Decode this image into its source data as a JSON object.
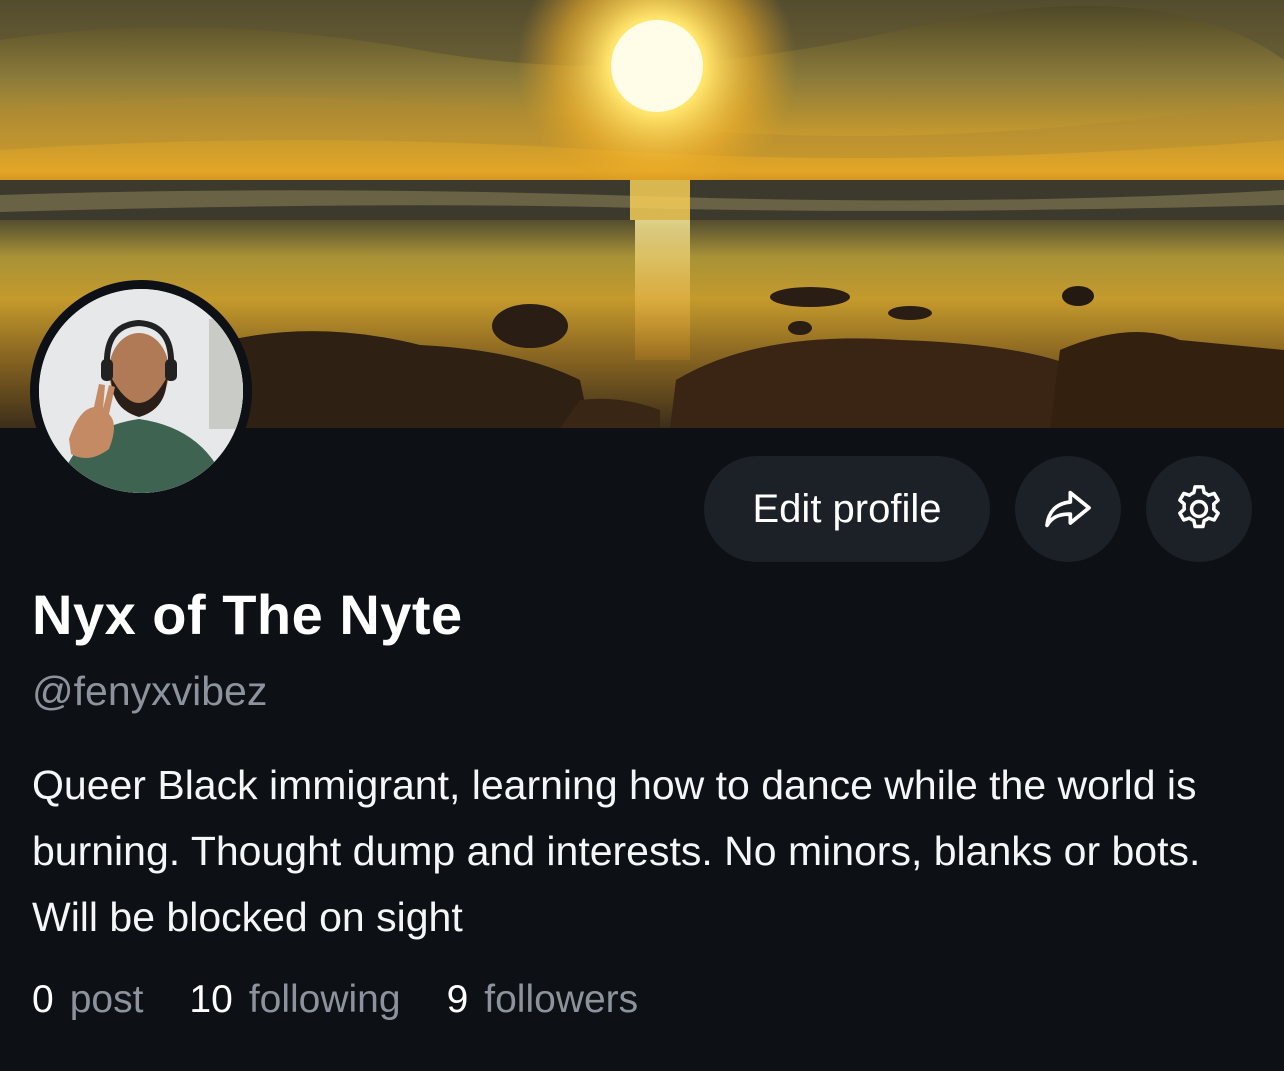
{
  "profile": {
    "display_name": "Nyx of The Nyte",
    "handle": "@fenyxvibez",
    "bio": "Queer Black immigrant, learning how to dance while the world is burning. Thought dump and interests. No minors, blanks or bots. Will be blocked on sight",
    "banner_image": "sunset-over-beach",
    "avatar_image": "bearded-man-with-headphones-peace-sign"
  },
  "actions": {
    "edit_label": "Edit profile",
    "share_icon": "share-arrow-icon",
    "settings_icon": "gear-icon"
  },
  "stats": {
    "posts_count": "0",
    "posts_label": "post",
    "following_count": "10",
    "following_label": "following",
    "followers_count": "9",
    "followers_label": "followers"
  },
  "colors": {
    "background": "#0d1014",
    "button_bg": "#1c2027",
    "muted_text": "#8c939c",
    "primary_text": "#ffffff"
  }
}
